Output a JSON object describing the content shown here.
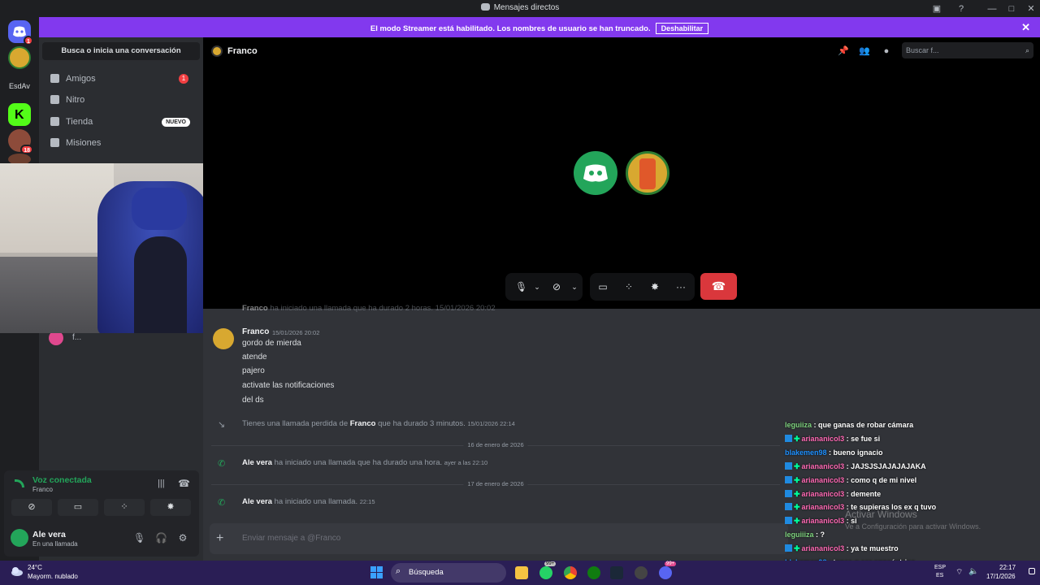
{
  "window": {
    "title": "Mensajes directos"
  },
  "banner": {
    "message": "El modo Streamer está habilitado. Los nombres de usuario se han truncado.",
    "button": "Deshabilitar"
  },
  "rail": {
    "home_badge": "1",
    "server_label": "EsdAv",
    "server_badge": "18"
  },
  "sidebar": {
    "search": "Busca o inicia una conversación",
    "items": [
      {
        "label": "Amigos",
        "count": "1"
      },
      {
        "label": "Nitro"
      },
      {
        "label": "Tienda",
        "tag": "NUEVO"
      },
      {
        "label": "Misiones"
      }
    ],
    "dm_partial": "f..."
  },
  "voice": {
    "title": "Voz conectada",
    "channel": "Franco"
  },
  "user": {
    "name": "Ale vera",
    "status": "En una llamada"
  },
  "call": {
    "name": "Franco",
    "search_placeholder": "Buscar f..."
  },
  "chat": {
    "cut_line": {
      "name": "Franco",
      "text": "ha iniciado una llamada que ha durado 2 horas. 15/01/2026 20:02"
    },
    "message": {
      "author": "Franco",
      "timestamp": "15/01/2026 20:02",
      "lines": [
        "gordo de mierda",
        "atende",
        "pajero",
        "activate las notificaciones",
        "del ds"
      ]
    },
    "missed": {
      "prefix": "Tienes una llamada perdida de",
      "name": "Franco",
      "suffix": "que ha durado 3 minutos.",
      "time": "15/01/2026 22:14"
    },
    "divider1": "16 de enero de 2026",
    "call1": {
      "name": "Ale vera",
      "text": "ha iniciado una llamada que ha durado una hora.",
      "time": "ayer a las 22:10"
    },
    "divider2": "17 de enero de 2026",
    "call2": {
      "name": "Ale vera",
      "text": "ha iniciado una llamada.",
      "time": "22:15"
    },
    "input_placeholder": "Enviar mensaje a @Franco"
  },
  "twitch": {
    "lines": [
      {
        "user": "leguiiza",
        "text": ": que ganas de robar cámara",
        "color": "#7fd37f",
        "badges": false
      },
      {
        "user": "ariananicol3",
        "text": ": se fue si",
        "color": "#ff69b4",
        "badges": true
      },
      {
        "user": "blakemen98",
        "text": ": bueno ignacio",
        "color": "#1e90ff",
        "badges": false
      },
      {
        "user": "ariananicol3",
        "text": ": JAJSJSJAJAJAJAKA",
        "color": "#ff69b4",
        "badges": true
      },
      {
        "user": "ariananicol3",
        "text": ": como q de mi nivel",
        "color": "#ff69b4",
        "badges": true
      },
      {
        "user": "ariananicol3",
        "text": ": demente",
        "color": "#ff69b4",
        "badges": true
      },
      {
        "user": "ariananicol3",
        "text": ": te supieras los ex q tuvo",
        "color": "#ff69b4",
        "badges": true
      },
      {
        "user": "ariananicol3",
        "text": ": si",
        "color": "#ff69b4",
        "badges": true
      },
      {
        "user": "leguiiiza",
        "text": ": ?",
        "color": "#7fd37f",
        "badges": false
      },
      {
        "user": "ariananicol3",
        "text": ": ya te muestro",
        "color": "#ff69b4",
        "badges": true
      },
      {
        "user": "blakemen98",
        "text": ": tenes q ser egocéntrico",
        "color": "#1e90ff",
        "badges": false
      },
      {
        "user": "blakemen98",
        "text": ": 👏🏻👏🏻👏🏻👏🏻👏🏻",
        "color": "#1e90ff",
        "badges": false
      }
    ],
    "watermark_title": "Activar Windows",
    "watermark_sub": "Ve a Configuración para activar Windows."
  },
  "taskbar": {
    "temperature": "24°C",
    "condition": "Mayorm. nublado",
    "search": "Búsqueda",
    "lang1": "ESP",
    "lang2": "ES",
    "time": "22:17",
    "date": "17/1/2026",
    "whatsapp_badge": "99+",
    "discord_badge": "99+"
  }
}
